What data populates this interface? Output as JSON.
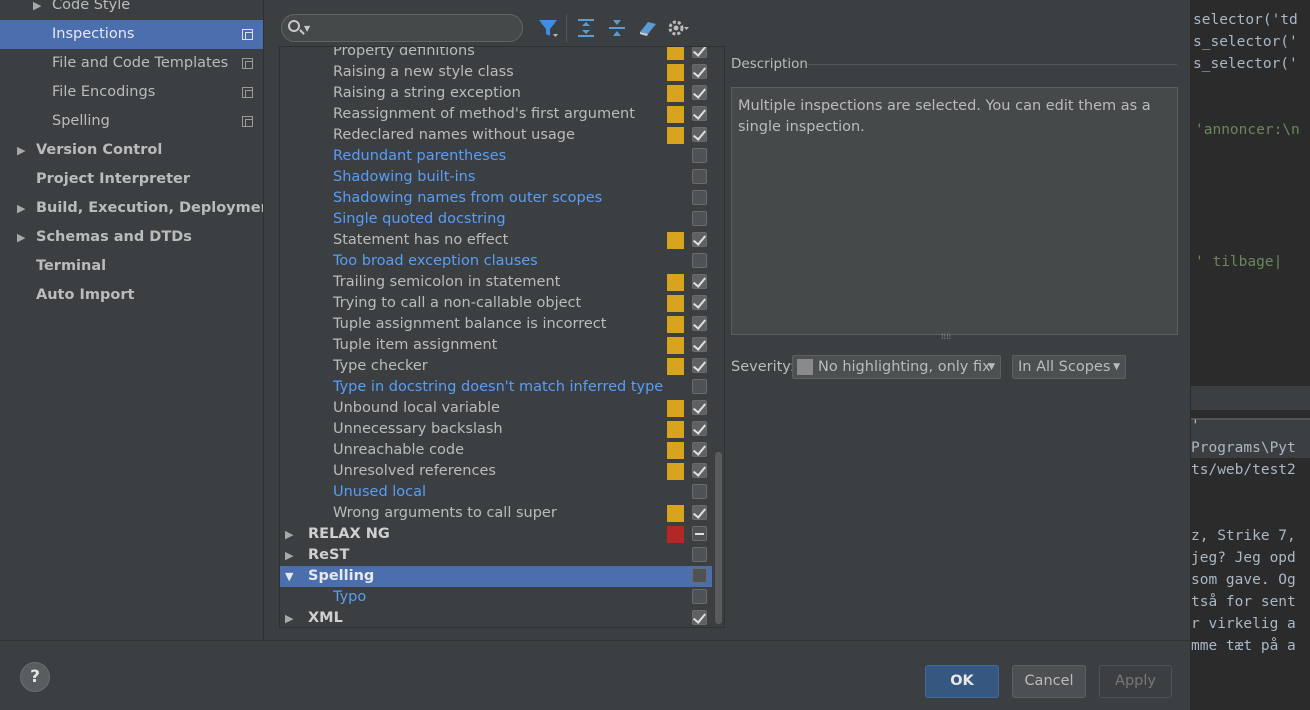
{
  "settings_tree": [
    {
      "label": "Code Style",
      "level": 1,
      "expandable": true,
      "selected": false,
      "bold": false,
      "copy_icon": false
    },
    {
      "label": "Inspections",
      "level": 1,
      "expandable": false,
      "selected": true,
      "bold": false,
      "copy_icon": true
    },
    {
      "label": "File and Code Templates",
      "level": 1,
      "expandable": false,
      "selected": false,
      "bold": false,
      "copy_icon": true
    },
    {
      "label": "File Encodings",
      "level": 1,
      "expandable": false,
      "selected": false,
      "bold": false,
      "copy_icon": true
    },
    {
      "label": "Spelling",
      "level": 1,
      "expandable": false,
      "selected": false,
      "bold": false,
      "copy_icon": true
    },
    {
      "label": "Version Control",
      "level": 0,
      "expandable": true,
      "selected": false,
      "bold": true,
      "copy_icon": false
    },
    {
      "label": "Project Interpreter",
      "level": 0,
      "expandable": false,
      "selected": false,
      "bold": true,
      "copy_icon": false
    },
    {
      "label": "Build, Execution, Deployment",
      "level": 0,
      "expandable": true,
      "selected": false,
      "bold": true,
      "copy_icon": false
    },
    {
      "label": "Schemas and DTDs",
      "level": 0,
      "expandable": true,
      "selected": false,
      "bold": true,
      "copy_icon": false
    },
    {
      "label": "Terminal",
      "level": 0,
      "expandable": false,
      "selected": false,
      "bold": true,
      "copy_icon": false
    },
    {
      "label": "Auto Import",
      "level": 0,
      "expandable": false,
      "selected": false,
      "bold": true,
      "copy_icon": false
    }
  ],
  "toolbar": {
    "search": {
      "placeholder": "",
      "value": ""
    },
    "icons": [
      "filter-icon",
      "expand-all-icon",
      "collapse-all-icon",
      "reset-icon",
      "gear-icon"
    ]
  },
  "inspections": [
    {
      "name": "Property definitions",
      "style": "normal",
      "severity": "warning",
      "checked": "on",
      "group": false
    },
    {
      "name": "Raising a new style class",
      "style": "normal",
      "severity": "warning",
      "checked": "on",
      "group": false
    },
    {
      "name": "Raising a string exception",
      "style": "normal",
      "severity": "warning",
      "checked": "on",
      "group": false
    },
    {
      "name": "Reassignment of method's first argument",
      "style": "normal",
      "severity": "warning",
      "checked": "on",
      "group": false
    },
    {
      "name": "Redeclared names without usage",
      "style": "normal",
      "severity": "warning",
      "checked": "on",
      "group": false
    },
    {
      "name": "Redundant parentheses",
      "style": "blue",
      "severity": "none",
      "checked": "off",
      "group": false
    },
    {
      "name": "Shadowing built-ins",
      "style": "blue",
      "severity": "none",
      "checked": "off",
      "group": false
    },
    {
      "name": "Shadowing names from outer scopes",
      "style": "blue",
      "severity": "none",
      "checked": "off",
      "group": false
    },
    {
      "name": "Single quoted docstring",
      "style": "blue",
      "severity": "none",
      "checked": "off",
      "group": false
    },
    {
      "name": "Statement has no effect",
      "style": "normal",
      "severity": "warning",
      "checked": "on",
      "group": false
    },
    {
      "name": "Too broad exception clauses",
      "style": "blue",
      "severity": "none",
      "checked": "off",
      "group": false
    },
    {
      "name": "Trailing semicolon in statement",
      "style": "normal",
      "severity": "warning",
      "checked": "on",
      "group": false
    },
    {
      "name": "Trying to call a non-callable object",
      "style": "normal",
      "severity": "warning",
      "checked": "on",
      "group": false
    },
    {
      "name": "Tuple assignment balance is incorrect",
      "style": "normal",
      "severity": "warning",
      "checked": "on",
      "group": false
    },
    {
      "name": "Tuple item assignment",
      "style": "normal",
      "severity": "warning",
      "checked": "on",
      "group": false
    },
    {
      "name": "Type checker",
      "style": "normal",
      "severity": "warning",
      "checked": "on",
      "group": false
    },
    {
      "name": "Type in docstring doesn't match inferred type",
      "style": "blue",
      "severity": "none",
      "checked": "off",
      "group": false
    },
    {
      "name": "Unbound local variable",
      "style": "normal",
      "severity": "warning",
      "checked": "on",
      "group": false
    },
    {
      "name": "Unnecessary backslash",
      "style": "normal",
      "severity": "warning",
      "checked": "on",
      "group": false
    },
    {
      "name": "Unreachable code",
      "style": "normal",
      "severity": "warning",
      "checked": "on",
      "group": false
    },
    {
      "name": "Unresolved references",
      "style": "normal",
      "severity": "warning",
      "checked": "on",
      "group": false
    },
    {
      "name": "Unused local",
      "style": "blue",
      "severity": "none",
      "checked": "off",
      "group": false
    },
    {
      "name": "Wrong arguments to call super",
      "style": "normal",
      "severity": "warning",
      "checked": "on",
      "group": false
    },
    {
      "name": "RELAX NG",
      "style": "group",
      "severity": "error",
      "checked": "mixed",
      "group": true,
      "expanded": false,
      "selected": false
    },
    {
      "name": "ReST",
      "style": "group",
      "severity": "none",
      "checked": "off",
      "group": true,
      "expanded": false,
      "selected": false
    },
    {
      "name": "Spelling",
      "style": "group",
      "severity": "none",
      "checked": "off",
      "group": true,
      "expanded": true,
      "selected": true
    },
    {
      "name": "Typo",
      "style": "blue",
      "severity": "none",
      "checked": "off",
      "group": false
    },
    {
      "name": "XML",
      "style": "group",
      "severity": "none",
      "checked": "on",
      "group": true,
      "expanded": false,
      "selected": false
    }
  ],
  "colors": {
    "warning": "#d9a31d",
    "error": "#b52727",
    "accent": "#4b6eaf",
    "blue_text": "#589df6"
  },
  "description": {
    "title": "Description",
    "text": "Multiple inspections are selected. You can edit them as a single inspection."
  },
  "severity": {
    "label": "Severity:",
    "value": "No highlighting, only fix",
    "scope": "In All Scopes"
  },
  "buttons": {
    "ok": "OK",
    "cancel": "Cancel",
    "apply": "Apply",
    "help": "?"
  },
  "editor": {
    "code_lines": [
      "selector('td",
      "s_selector('",
      "s_selector('",
      "",
      "",
      "'annoncer:\\n",
      "",
      "",
      "",
      "",
      "",
      "' tilbage|"
    ],
    "console_lines": [
      "'",
      "Programs\\Pyt",
      "ts/web/test2",
      "",
      "",
      "z, Strike 7,",
      "jeg? Jeg opd",
      "som gave. Og",
      "tså for sent",
      "r virkelig a",
      "mme tæt på a"
    ]
  }
}
